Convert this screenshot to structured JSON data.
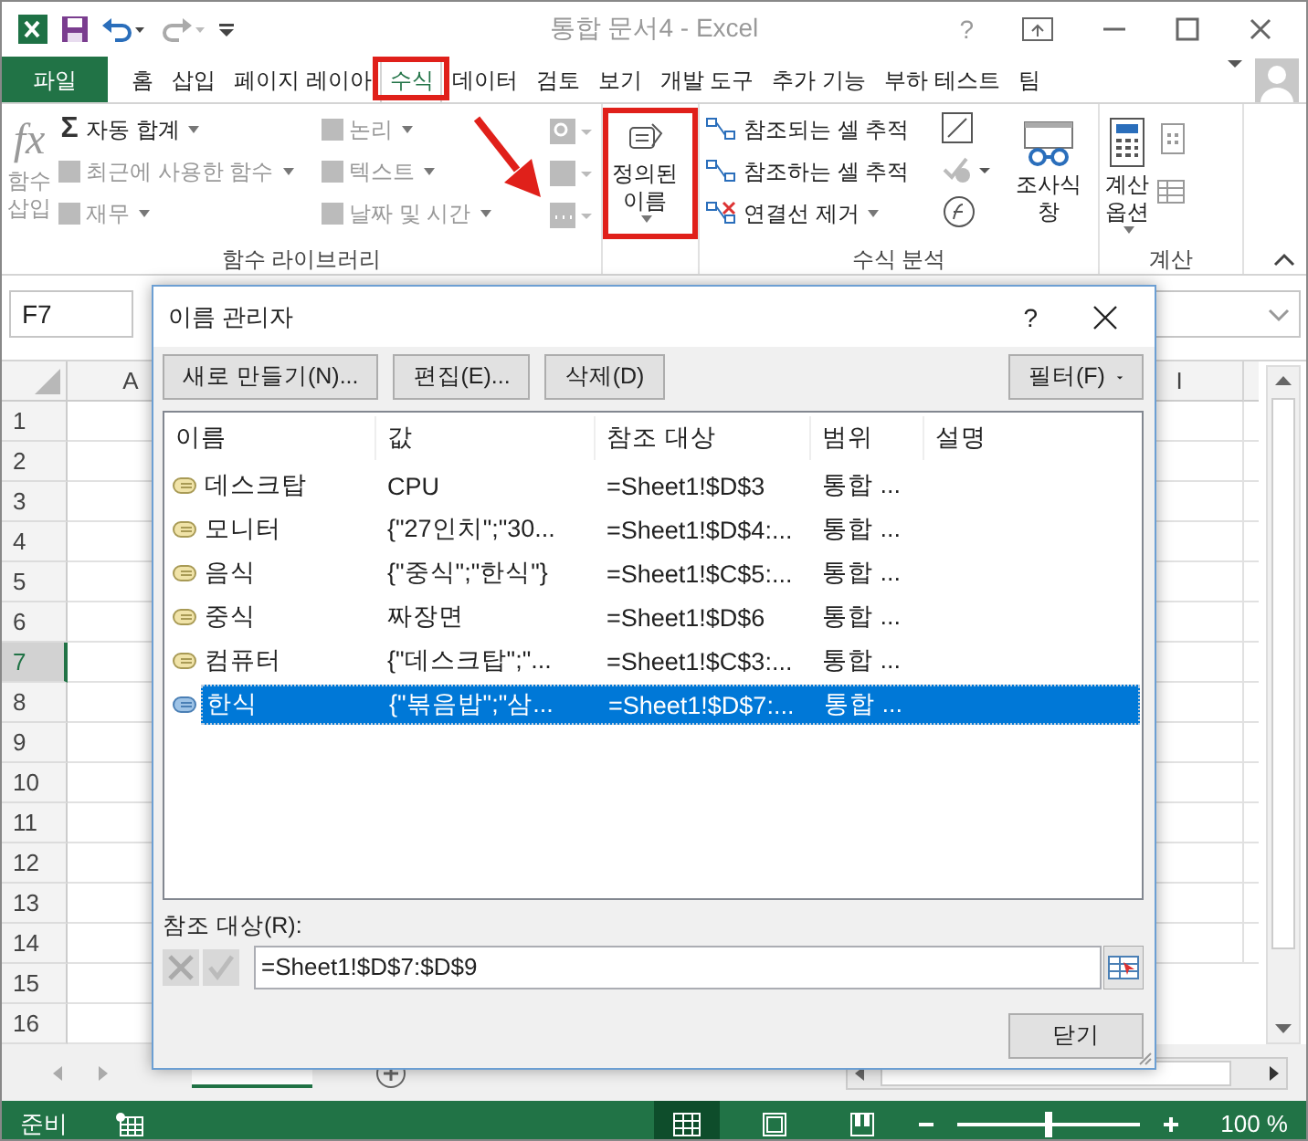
{
  "window": {
    "title": "통합 문서4 - Excel",
    "help": "?"
  },
  "ribbon_tabs": [
    {
      "label": "파일",
      "kind": "file",
      "selected": false
    },
    {
      "label": "홈",
      "kind": "tab",
      "selected": false
    },
    {
      "label": "삽입",
      "kind": "tab",
      "selected": false
    },
    {
      "label": "페이지 레이아",
      "kind": "tab",
      "selected": false
    },
    {
      "label": "수식",
      "kind": "tab",
      "selected": true
    },
    {
      "label": "데이터",
      "kind": "tab",
      "selected": false
    },
    {
      "label": "검토",
      "kind": "tab",
      "selected": false
    },
    {
      "label": "보기",
      "kind": "tab",
      "selected": false
    },
    {
      "label": "개발 도구",
      "kind": "tab",
      "selected": false
    },
    {
      "label": "추가 기능",
      "kind": "tab",
      "selected": false
    },
    {
      "label": "부하 테스트",
      "kind": "tab",
      "selected": false
    },
    {
      "label": "팀",
      "kind": "tab",
      "selected": false
    }
  ],
  "function_library": {
    "insert_function": {
      "glyph": "fx",
      "label": "함수 삽입",
      "disabled": true
    },
    "column_1": [
      {
        "glyph": "Σ",
        "label": "자동 합계",
        "disabled": false
      },
      {
        "label": "최근에 사용한 함수",
        "disabled": true
      },
      {
        "label": "재무",
        "disabled": true
      }
    ],
    "column_2": [
      {
        "label": "논리",
        "disabled": true
      },
      {
        "label": "텍스트",
        "disabled": true
      },
      {
        "label": "날짜 및 시간",
        "disabled": true
      }
    ],
    "group_label": "함수 라이브러리"
  },
  "defined_names": {
    "label": "정의된 이름"
  },
  "formula_auditing": {
    "items": [
      {
        "label": "참조되는 셀 추적",
        "dropdown": false
      },
      {
        "label": "참조하는 셀 추적",
        "dropdown": false
      },
      {
        "label": "연결선 제거",
        "dropdown": true
      }
    ],
    "watch_window": "조사식 창",
    "group_label": "수식 분석"
  },
  "calculation": {
    "options": "계산 옵션",
    "group_label": "계산"
  },
  "name_box": "F7",
  "columns": [
    "A",
    "I"
  ],
  "rows": [
    {
      "label": "1",
      "selected": false
    },
    {
      "label": "2",
      "selected": false
    },
    {
      "label": "3",
      "selected": false
    },
    {
      "label": "4",
      "selected": false
    },
    {
      "label": "5",
      "selected": false
    },
    {
      "label": "6",
      "selected": false
    },
    {
      "label": "7",
      "selected": true
    },
    {
      "label": "8",
      "selected": false
    },
    {
      "label": "9",
      "selected": false
    },
    {
      "label": "10",
      "selected": false
    },
    {
      "label": "11",
      "selected": false
    },
    {
      "label": "12",
      "selected": false
    },
    {
      "label": "13",
      "selected": false
    },
    {
      "label": "14",
      "selected": false
    },
    {
      "label": "15",
      "selected": false
    },
    {
      "label": "16",
      "selected": false
    }
  ],
  "dialog": {
    "title": "이름 관리자",
    "help": "?",
    "buttons": [
      "새로 만들기(N)...",
      "편집(E)...",
      "삭제(D)"
    ],
    "filter": "필터(F)",
    "columns": [
      "이름",
      "값",
      "참조 대상",
      "범위",
      "설명"
    ],
    "rows": [
      {
        "name": "데스크탑",
        "value": "CPU",
        "refers_to": "=Sheet1!$D$3",
        "scope": "통합 ...",
        "selected": false
      },
      {
        "name": "모니터",
        "value": "{\"27인치\";\"30...",
        "refers_to": "=Sheet1!$D$4:...",
        "scope": "통합 ...",
        "selected": false
      },
      {
        "name": "음식",
        "value": "{\"중식\";\"한식\"}",
        "refers_to": "=Sheet1!$C$5:...",
        "scope": "통합 ...",
        "selected": false
      },
      {
        "name": "중식",
        "value": "짜장면",
        "refers_to": "=Sheet1!$D$6",
        "scope": "통합 ...",
        "selected": false
      },
      {
        "name": "컴퓨터",
        "value": "{\"데스크탑\";\"...",
        "refers_to": "=Sheet1!$C$3:...",
        "scope": "통합 ...",
        "selected": false
      },
      {
        "name": "한식",
        "value": "{\"볶음밥\";\"삼...",
        "refers_to": "=Sheet1!$D$7:...",
        "scope": "통합 ...",
        "selected": true
      }
    ],
    "refers_to_label": "참조 대상(R):",
    "refers_to_value": "=Sheet1!$D$7:$D$9",
    "close": "닫기"
  },
  "status_bar": {
    "status": "준비",
    "zoom": "100 %",
    "zoom_slider": {
      "level": 0.5
    }
  }
}
